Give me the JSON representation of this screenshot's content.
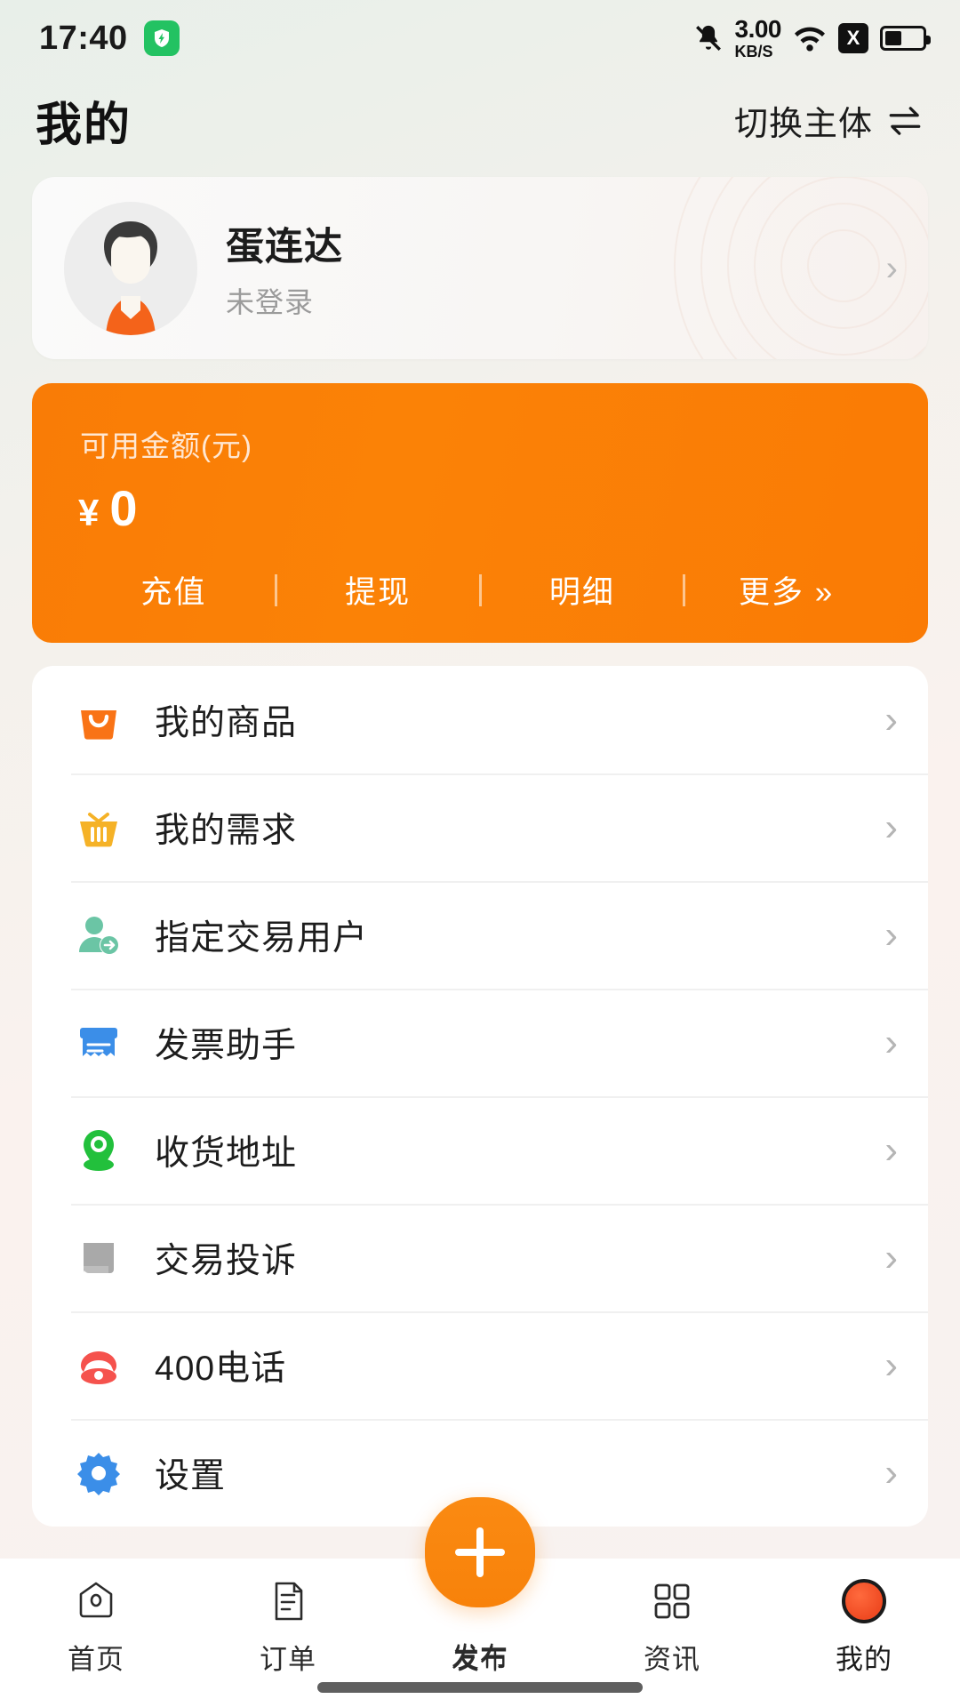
{
  "status_bar": {
    "time": "17:40",
    "shield_icon": "shield-check-icon",
    "bell_icon": "bell-muted-icon",
    "net_speed_value": "3.00",
    "net_speed_unit": "KB/S",
    "wifi_icon": "wifi-icon",
    "x_badge": "X",
    "battery_icon": "battery-half-icon"
  },
  "header": {
    "title": "我的",
    "switch_entity_label": "切换主体",
    "switch_entity_icon": "switch-arrows-icon"
  },
  "profile": {
    "avatar_icon": "user-avatar",
    "name": "蛋连达",
    "status": "未登录",
    "chevron": "›"
  },
  "wallet": {
    "label": "可用金额(元)",
    "currency": "¥",
    "amount": "0",
    "actions": [
      {
        "label": "充值",
        "name": "recharge"
      },
      {
        "label": "提现",
        "name": "withdraw"
      },
      {
        "label": "明细",
        "name": "details"
      },
      {
        "label": "更多 »",
        "name": "more"
      }
    ],
    "bg_color": "#f97c06"
  },
  "menu": {
    "items": [
      {
        "label": "我的商品",
        "icon": "shopping-bag-icon",
        "color": "#f97316",
        "chevron": "›"
      },
      {
        "label": "我的需求",
        "icon": "basket-icon",
        "color": "#f5b227",
        "chevron": "›"
      },
      {
        "label": "指定交易用户",
        "icon": "user-assign-icon",
        "color": "#6bc5a5",
        "chevron": "›"
      },
      {
        "label": "发票助手",
        "icon": "invoice-icon",
        "color": "#3b8ee8",
        "chevron": "›"
      },
      {
        "label": "收货地址",
        "icon": "location-pin-icon",
        "color": "#22c03c",
        "chevron": "›"
      },
      {
        "label": "交易投诉",
        "icon": "complaint-doc-icon",
        "color": "#a9a9a9",
        "chevron": "›"
      },
      {
        "label": "400电话",
        "icon": "telephone-icon",
        "color": "#f5524d",
        "chevron": "›"
      },
      {
        "label": "设置",
        "icon": "gear-icon",
        "color": "#3b8ee8",
        "chevron": "›"
      }
    ]
  },
  "tabbar": {
    "items": [
      {
        "label": "首页",
        "icon": "home-icon",
        "active": false
      },
      {
        "label": "订单",
        "icon": "order-doc-icon",
        "active": false
      },
      {
        "label": "发布",
        "icon": "plus-icon",
        "active": false
      },
      {
        "label": "资讯",
        "icon": "grid-icon",
        "active": false
      },
      {
        "label": "我的",
        "icon": "profile-avatar-icon",
        "active": true
      }
    ],
    "fab_icon": "plus-icon",
    "fab_color": "#f8820a"
  }
}
